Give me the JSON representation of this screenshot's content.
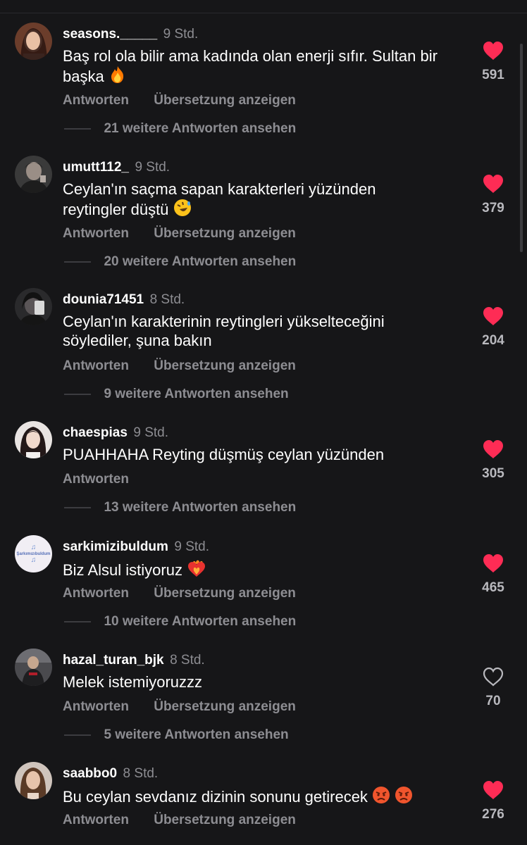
{
  "comments": [
    {
      "username": "seasons._____",
      "time": "9 Std.",
      "text": "Baş rol ola bilir ama kadında olan enerji sıfır. Sultan bir başka",
      "emoji": "fire",
      "likes": "591",
      "liked": true,
      "reply_label": "Antworten",
      "translate_label": "Übersetzung anzeigen",
      "more_replies": "21 weitere Antworten ansehen"
    },
    {
      "username": "umutt112_",
      "time": "9 Std.",
      "text": "Ceylan'ın saçma sapan karakterleri yüzünden reytingler düştü",
      "emoji": "rofl",
      "likes": "379",
      "liked": true,
      "reply_label": "Antworten",
      "translate_label": "Übersetzung anzeigen",
      "more_replies": "20 weitere Antworten ansehen"
    },
    {
      "username": "dounia71451",
      "time": "8 Std.",
      "text": "Ceylan'ın karakterinin reytingleri yükselteceğini söylediler, şuna bakın",
      "emoji": "",
      "likes": "204",
      "liked": true,
      "reply_label": "Antworten",
      "translate_label": "Übersetzung anzeigen",
      "more_replies": "9 weitere Antworten ansehen"
    },
    {
      "username": "chaespias",
      "time": "9 Std.",
      "text": "PUAHHAHA Reyting düşmüş ceylan yüzünden",
      "emoji": "",
      "likes": "305",
      "liked": true,
      "reply_label": "Antworten",
      "translate_label": "",
      "more_replies": "13 weitere Antworten ansehen"
    },
    {
      "username": "sarkimizibuldum",
      "time": "9 Std.",
      "text": "Biz Alsul istiyoruz",
      "emoji": "heart-on-fire",
      "likes": "465",
      "liked": true,
      "avatar_text": "Şarkımızıbuldum",
      "reply_label": "Antworten",
      "translate_label": "Übersetzung anzeigen",
      "more_replies": "10 weitere Antworten ansehen"
    },
    {
      "username": "hazal_turan_bjk",
      "time": "8 Std.",
      "text": "Melek istemiyoruzzz",
      "emoji": "",
      "likes": "70",
      "liked": false,
      "reply_label": "Antworten",
      "translate_label": "Übersetzung anzeigen",
      "more_replies": "5 weitere Antworten ansehen"
    },
    {
      "username": "saabbo0",
      "time": "8 Std.",
      "text": "Bu ceylan sevdanız dizinin sonunu getirecek",
      "emoji": "angry-angry",
      "likes": "276",
      "liked": true,
      "reply_label": "Antworten",
      "translate_label": "Übersetzung anzeigen",
      "more_replies": ""
    }
  ],
  "colors": {
    "background": "#161618",
    "like_red": "#fe2c55",
    "secondary_text": "#8d8d92"
  }
}
